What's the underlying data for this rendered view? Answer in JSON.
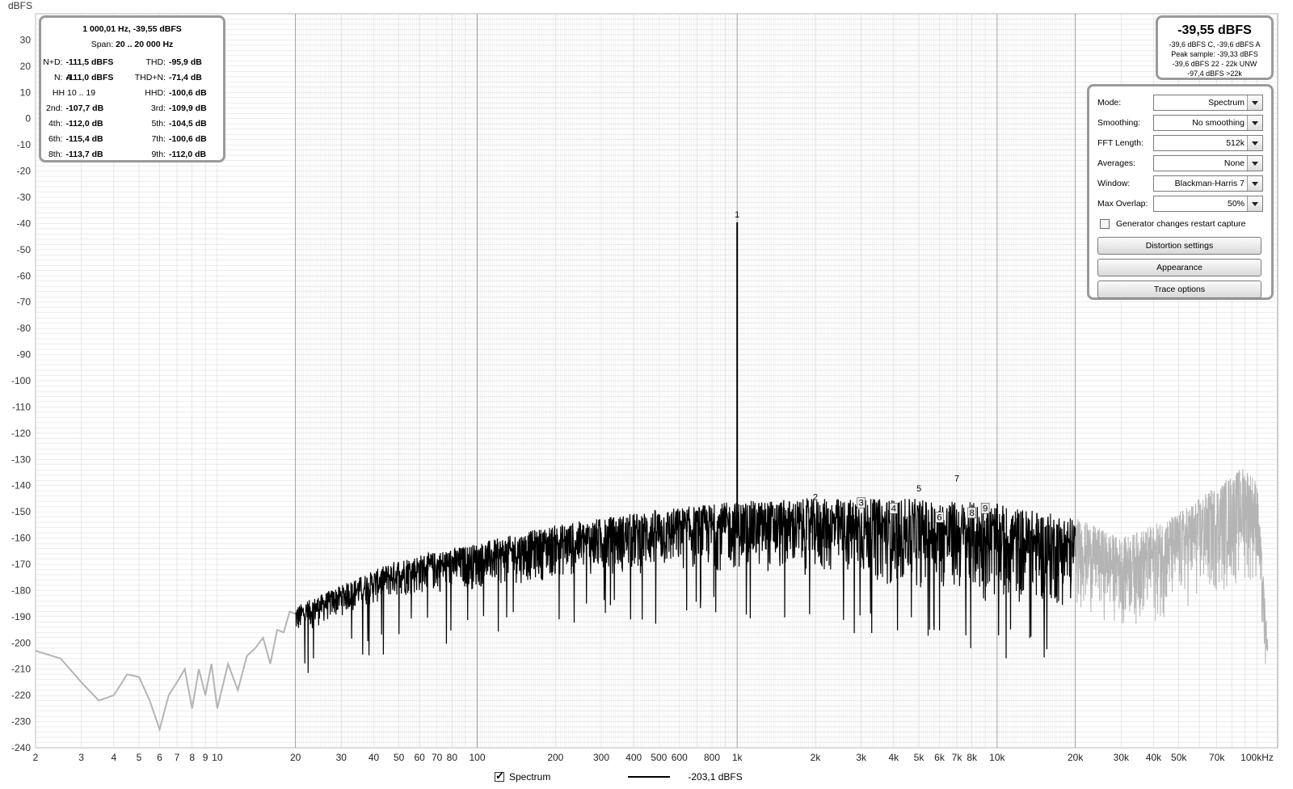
{
  "axis": {
    "y_unit": "dBFS",
    "y_ticks": [
      "30",
      "20",
      "10",
      "0",
      "-10",
      "-20",
      "-30",
      "-40",
      "-50",
      "-60",
      "-70",
      "-80",
      "-90",
      "-100",
      "-110",
      "-120",
      "-130",
      "-140",
      "-150",
      "-160",
      "-170",
      "-180",
      "-190",
      "-200",
      "-210",
      "-220",
      "-230",
      "-240"
    ],
    "x_ticks": [
      "2",
      "3",
      "4",
      "5",
      "6",
      "7",
      "8",
      "9",
      "10",
      "20",
      "30",
      "40",
      "50",
      "60",
      "70",
      "80",
      "100",
      "200",
      "300",
      "400",
      "500",
      "600",
      "800",
      "1k",
      "2k",
      "3k",
      "4k",
      "5k",
      "6k",
      "7k",
      "8k",
      "10k",
      "20k",
      "30k",
      "40k",
      "50k",
      "70k",
      "100kHz"
    ],
    "x_tick_values": [
      2,
      3,
      4,
      5,
      6,
      7,
      8,
      9,
      10,
      20,
      30,
      40,
      50,
      60,
      70,
      80,
      100,
      200,
      300,
      400,
      500,
      600,
      800,
      1000,
      2000,
      3000,
      4000,
      5000,
      6000,
      7000,
      8000,
      10000,
      20000,
      30000,
      40000,
      50000,
      70000,
      100000
    ]
  },
  "info_panel": {
    "peak": "1 000,01 Hz, -39,55 dBFS",
    "span_label": "Span:",
    "span_value": "20 .. 20 000 Hz",
    "rows": [
      {
        "l1": "N+D:",
        "v1": "-111,5 dBFS A",
        "l2": "THD:",
        "v2": "-95,9 dB"
      },
      {
        "l1": "N:",
        "v1": "-111,0 dBFS",
        "l2": "THD+N:",
        "v2": "-71,4 dB"
      },
      {
        "l1": "HH 10 .. 19",
        "v1": "",
        "l2": "HHD:",
        "v2": "-100,6 dB"
      },
      {
        "l1": "2nd:",
        "v1": "-107,7 dB",
        "l2": "3rd:",
        "v2": "-109,9 dB"
      },
      {
        "l1": "4th:",
        "v1": "-112,0 dB",
        "l2": "5th:",
        "v2": "-104,5 dB"
      },
      {
        "l1": "6th:",
        "v1": "-115,4 dB",
        "l2": "7th:",
        "v2": "-100,6 dB"
      },
      {
        "l1": "8th:",
        "v1": "-113,7 dB",
        "l2": "9th:",
        "v2": "-112,0 dB"
      }
    ]
  },
  "level_panel": {
    "main": "-39,55 dBFS",
    "line1": "-39,6 dBFS C, -39,6 dBFS A",
    "line2": "Peak sample: -39,33 dBFS",
    "line3": "-39,6 dBFS 22 - 22k UNW",
    "line4": "-97,4 dBFS >22k"
  },
  "controls": {
    "mode": {
      "label": "Mode:",
      "value": "Spectrum"
    },
    "smoothing": {
      "label": "Smoothing:",
      "value": "No  smoothing"
    },
    "fft_length": {
      "label": "FFT Length:",
      "value": "512k"
    },
    "averages": {
      "label": "Averages:",
      "value": "None"
    },
    "window": {
      "label": "Window:",
      "value": "Blackman-Harris 7"
    },
    "max_overlap": {
      "label": "Max Overlap:",
      "value": "50%"
    },
    "restart_checkbox": "Generator changes restart capture",
    "distortion_button": "Distortion settings",
    "appearance_button": "Appearance",
    "trace_button": "Trace options"
  },
  "legend": {
    "series_name": "Spectrum",
    "cursor_value": "-203,1 dBFS"
  },
  "chart_data": {
    "type": "line",
    "x_scale": "log",
    "xlim": [
      2,
      120000
    ],
    "ylim": [
      -240,
      40
    ],
    "ylabel": "dBFS",
    "band_hz": [
      20,
      20000
    ],
    "colors": {
      "in_band": "#000000",
      "out_of_band": "#b4b4b4",
      "grid": "#d8d8d8",
      "grid_major": "#8c8c8c"
    },
    "fundamental": {
      "x": 1000,
      "y": -39.55
    },
    "harmonic_markers": [
      {
        "label": "1",
        "x": 1000,
        "y": -39.55
      },
      {
        "label": "2",
        "x": 2000,
        "y": -147.3
      },
      {
        "label": "3",
        "x": 3000,
        "y": -149.5
      },
      {
        "label": "4",
        "x": 4000,
        "y": -151.6
      },
      {
        "label": "5",
        "x": 5000,
        "y": -144.1
      },
      {
        "label": "6",
        "x": 6000,
        "y": -155.0
      },
      {
        "label": "7",
        "x": 7000,
        "y": -140.2
      },
      {
        "label": "8",
        "x": 8000,
        "y": -153.3
      },
      {
        "label": "9",
        "x": 9000,
        "y": -151.6
      }
    ],
    "low_curve": {
      "x": [
        2,
        2.5,
        3,
        3.5,
        4,
        4.5,
        5,
        5.5,
        6,
        6.5,
        7,
        7.5,
        8,
        8.5,
        9,
        9.5,
        10,
        11,
        12,
        13,
        14,
        15,
        16,
        17,
        18,
        19,
        20
      ],
      "y": [
        -203,
        -206,
        -215,
        -222,
        -220,
        -212,
        -213,
        -222,
        -233,
        -220,
        -215,
        -210,
        -225,
        -210,
        -220,
        -208,
        -225,
        -208,
        -218,
        -205,
        -202,
        -198,
        -208,
        -195,
        -196,
        -188,
        -189
      ]
    },
    "envelope_top": {
      "x": [
        20,
        30,
        50,
        100,
        200,
        500,
        1000,
        2000,
        5000,
        10000,
        20000
      ],
      "y": [
        -186,
        -178,
        -168,
        -162,
        -155,
        -149,
        -146,
        -145,
        -145,
        -147,
        -152
      ]
    },
    "envelope_bottom": {
      "x": [
        20,
        30,
        50,
        100,
        200,
        500,
        1000,
        2000,
        5000,
        10000,
        20000
      ],
      "y": [
        -198,
        -190,
        -183,
        -180,
        -176,
        -174,
        -173,
        -175,
        -180,
        -186,
        -188
      ]
    },
    "high_band": {
      "x": [
        20000,
        30000,
        40000,
        50000,
        70000,
        90000,
        100000,
        110000
      ],
      "y_top": [
        -152,
        -160,
        -155,
        -150,
        -140,
        -132,
        -138,
        -200
      ],
      "y_bottom": [
        -188,
        -195,
        -195,
        -190,
        -185,
        -180,
        -180,
        -225
      ]
    }
  }
}
